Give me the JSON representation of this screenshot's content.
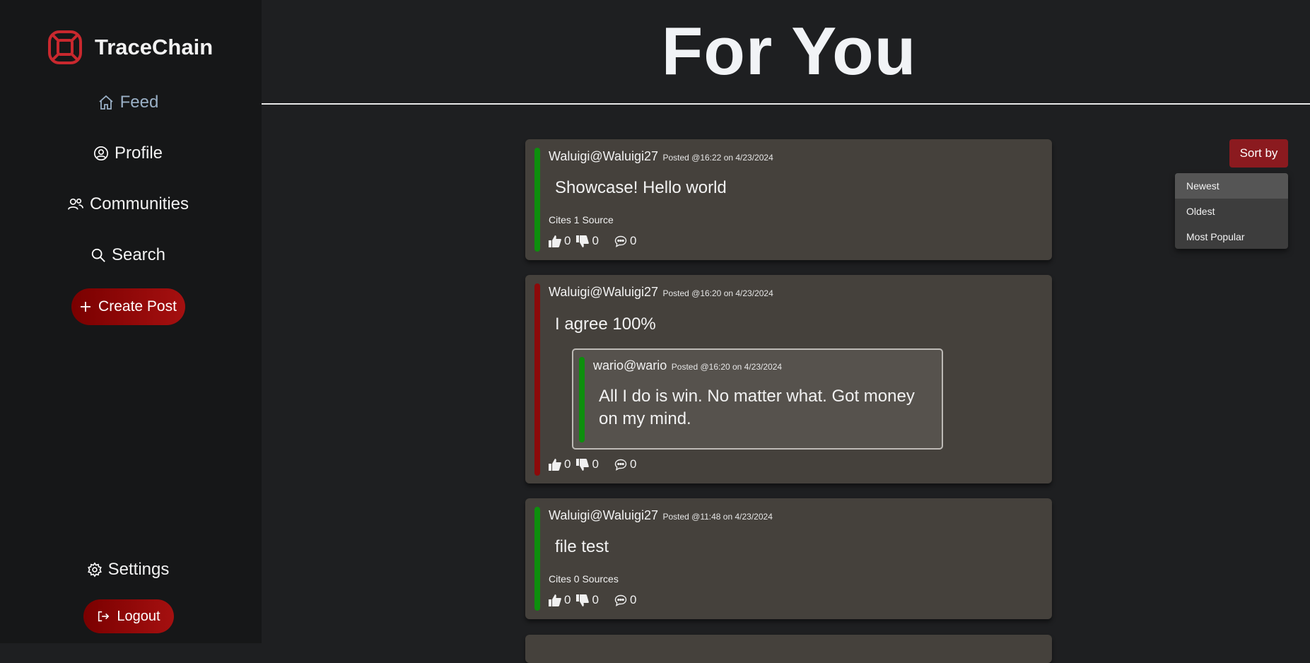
{
  "sidebar": {
    "brand": "TraceChain",
    "nav": [
      {
        "label": "Feed",
        "icon": "home-icon",
        "active": true
      },
      {
        "label": "Profile",
        "icon": "user-circle-icon"
      },
      {
        "label": "Communities",
        "icon": "users-icon"
      },
      {
        "label": "Search",
        "icon": "search-icon"
      }
    ],
    "create_post": "Create Post",
    "settings": "Settings",
    "logout": "Logout"
  },
  "header": {
    "title": "For You"
  },
  "sort": {
    "button_label": "Sort by",
    "options": [
      "Newest",
      "Oldest",
      "Most Popular"
    ],
    "selected": "Newest"
  },
  "posts": [
    {
      "author": "Waluigi@Waluigi27",
      "posted": "Posted @16:22 on 4/23/2024",
      "body": "Showcase! Hello world",
      "cites": "Cites 1 Source",
      "bar_color": "#0d8f0d",
      "likes": "0",
      "dislikes": "0",
      "comments": "0"
    },
    {
      "author": "Waluigi@Waluigi27",
      "posted": "Posted @16:20 on 4/23/2024",
      "body": "I agree 100%",
      "bar_color": "#8c0a0a",
      "quoted": {
        "author": "wario@wario",
        "posted": "Posted @16:20 on 4/23/2024",
        "body": "All I do is win. No matter what. Got money on my mind."
      },
      "likes": "0",
      "dislikes": "0",
      "comments": "0"
    },
    {
      "author": "Waluigi@Waluigi27",
      "posted": "Posted @11:48 on 4/23/2024",
      "body": "file test",
      "cites": "Cites 0 Sources",
      "bar_color": "#0d8f0d",
      "likes": "0",
      "dislikes": "0",
      "comments": "0"
    }
  ],
  "colors": {
    "accent": "#8b1a1f",
    "sidebar": "#161718",
    "card": "#45413c",
    "agree": "#0d8f0d",
    "disagree": "#8c0a0a"
  }
}
